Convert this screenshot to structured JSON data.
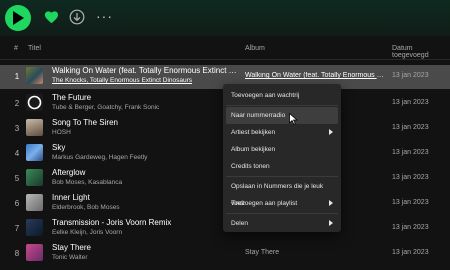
{
  "toolbar": {
    "play_icon": "play-icon",
    "heart_icon": "heart-icon",
    "download_icon": "download-icon",
    "more_label": "···"
  },
  "columns": {
    "num": "#",
    "title": "Titel",
    "album": "Album",
    "date": "Datum toegevoegd"
  },
  "tracks": [
    {
      "num": "1",
      "title": "Walking On Water (feat. Totally Enormous Extinct Din…",
      "artist": "The Knocks, Totally Enormous Extinct Dinosaurs",
      "album": "Walking On Water (feat. Totally Enormous Extinct Din…",
      "date": "13 jan 2023"
    },
    {
      "num": "2",
      "title": "The Future",
      "artist": "Tube & Berger, Goatchy, Frank Sonic",
      "album": "",
      "date": "13 jan 2023"
    },
    {
      "num": "3",
      "title": "Song To The Siren",
      "artist": "HOSH",
      "album": "",
      "date": "13 jan 2023"
    },
    {
      "num": "4",
      "title": "Sky",
      "artist": "Markus Gardeweg, Hagen Feetly",
      "album": "",
      "date": "13 jan 2023"
    },
    {
      "num": "5",
      "title": "Afterglow",
      "artist": "Bob Moses, Kasablanca",
      "album": "",
      "date": "13 jan 2023"
    },
    {
      "num": "6",
      "title": "Inner Light",
      "artist": "Elderbrook, Bob Moses",
      "album": "",
      "date": "13 jan 2023"
    },
    {
      "num": "7",
      "title": "Transmission - Joris Voorn Remix",
      "artist": "Eelke Kleijn, Joris Voorn",
      "album": "",
      "date": "13 jan 2023"
    },
    {
      "num": "8",
      "title": "Stay There",
      "artist": "Tonic Walter",
      "album": "Stay There",
      "date": "13 jan 2023"
    }
  ],
  "context_menu": {
    "items": [
      {
        "label": "Toevoegen aan wachtrij"
      },
      {
        "label": "Naar nummerradio"
      },
      {
        "label": "Artiest bekijken"
      },
      {
        "label": "Album bekijken"
      },
      {
        "label": "Credits tonen"
      },
      {
        "label": "Opslaan in Nummers die je leuk vindt"
      },
      {
        "label": "Toevoegen aan playlist"
      },
      {
        "label": "Delen"
      }
    ]
  },
  "colors": {
    "accent": "#1ed760",
    "background": "#121212",
    "menu": "#282828"
  }
}
